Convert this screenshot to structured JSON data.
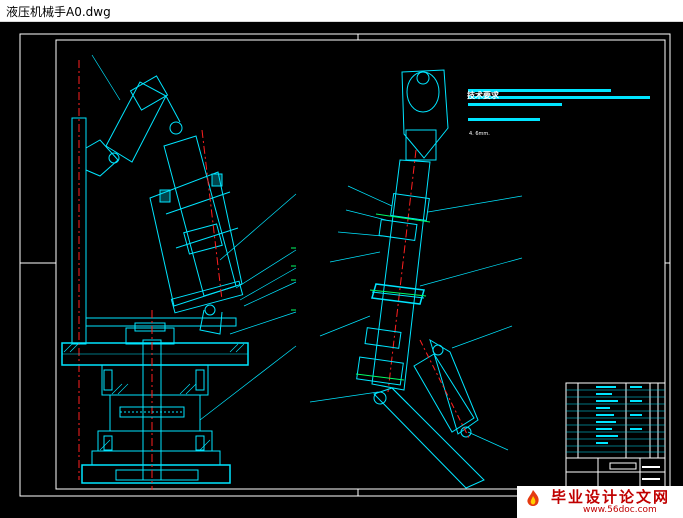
{
  "window": {
    "title": "液压机械手A0.dwg"
  },
  "drawing": {
    "notes_title": "技术要求",
    "notes_sub": "4. 6mm.",
    "colors": {
      "background": "#000000",
      "line_cyan": "#00e5ff",
      "frame_white": "#ffffff",
      "green": "#00ff66",
      "red": "#ff2020"
    }
  },
  "watermark": {
    "title": "毕业设计论文网",
    "url": "www.56doc.com",
    "logo_icon": "flame-logo-icon"
  }
}
